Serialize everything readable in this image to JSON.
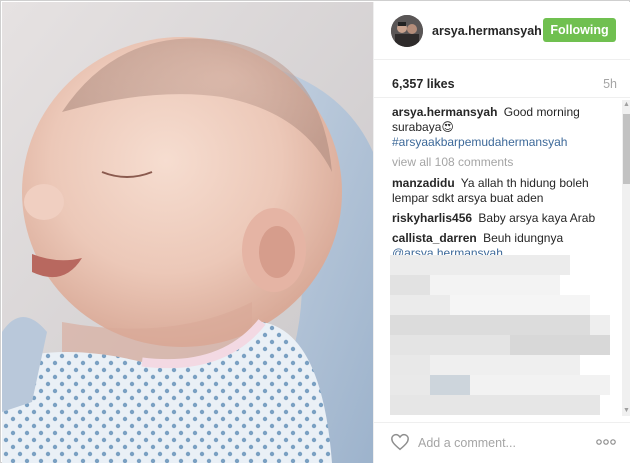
{
  "post": {
    "username": "arsya.hermansyah",
    "follow_label": "Following",
    "likes": "6,357 likes",
    "timestamp": "5h"
  },
  "caption": {
    "username": "arsya.hermansyah",
    "text": "Good morning surabaya😍",
    "hashtag": "#arsyaakbarpemudahermansyah"
  },
  "view_all": "view all 108 comments",
  "comments": [
    {
      "username": "manzadidu",
      "text": "Ya allah th hidung boleh lempar sdkt arsya buat aden",
      "mention": ""
    },
    {
      "username": "riskyharlis456",
      "text": "Baby arsya kaya Arab",
      "mention": ""
    },
    {
      "username": "callista_darren",
      "text": "Beuh idungnya",
      "mention": "@arsya.hermansyah"
    }
  ],
  "footer": {
    "comment_placeholder": "Add a comment...",
    "heart_icon": "heart-outline-icon",
    "more_icon": "more-options-icon"
  },
  "colors": {
    "follow_green": "#70c050",
    "hashtag_blue": "#3d6999",
    "muted": "#a5a5a5"
  }
}
